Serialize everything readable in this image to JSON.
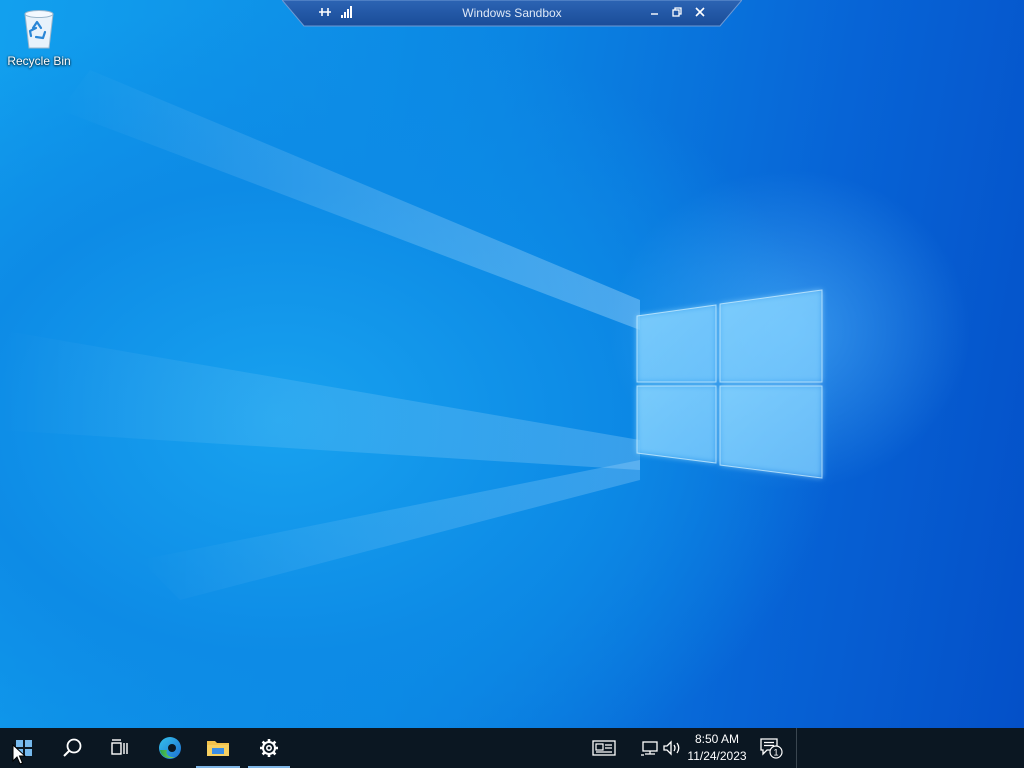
{
  "desktop": {
    "icons": [
      {
        "label": "Recycle Bin",
        "icon": "recycle-bin-icon"
      }
    ]
  },
  "sandbox_bar": {
    "title": "Windows Sandbox",
    "buttons": [
      "pin-icon",
      "signal-icon",
      "minimize-icon",
      "restore-icon",
      "close-icon"
    ]
  },
  "taskbar": {
    "items": [
      {
        "name": "start",
        "icon": "windows-start-icon"
      },
      {
        "name": "search",
        "icon": "search-icon"
      },
      {
        "name": "task-view",
        "icon": "task-view-icon"
      },
      {
        "name": "edge",
        "icon": "edge-icon"
      },
      {
        "name": "file-explorer",
        "icon": "folder-icon",
        "active": true
      },
      {
        "name": "settings",
        "icon": "gear-icon",
        "active": true
      }
    ],
    "tray": {
      "icons": [
        "news-icon",
        "network-icon",
        "volume-icon"
      ],
      "time": "8:50 AM",
      "date": "11/24/2023",
      "notification_count": "1"
    }
  },
  "colors": {
    "taskbar": "#0b1722",
    "wallpaper_accent": "#0a63d4",
    "active_indicator": "#7fb6e6"
  }
}
